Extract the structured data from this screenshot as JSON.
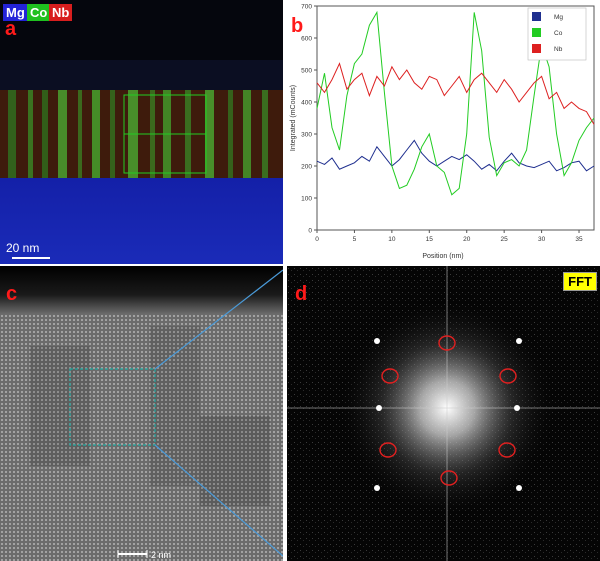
{
  "panel_a": {
    "label": "a",
    "legend": [
      {
        "name": "Mg",
        "color": "#2323d8"
      },
      {
        "name": "Co",
        "color": "#1fc01f"
      },
      {
        "name": "Nb",
        "color": "#d81e1e"
      }
    ],
    "scale_bar": "20 nm"
  },
  "panel_b": {
    "label": "b"
  },
  "panel_c": {
    "label": "c",
    "scale_bar": "2 nm"
  },
  "panel_d": {
    "label": "d",
    "badge": "FFT"
  },
  "chart_data": {
    "type": "line",
    "xlabel": "Position (nm)",
    "ylabel": "Integrated (mCounts)",
    "xlim": [
      0,
      37
    ],
    "ylim": [
      0,
      700
    ],
    "xticks": [
      "0",
      "5",
      "10",
      "15",
      "20",
      "25",
      "30",
      "35"
    ],
    "yticks": [
      "0",
      "100",
      "200",
      "300",
      "400",
      "500",
      "600",
      "700"
    ],
    "grid": false,
    "legend_position": "top-right",
    "series": [
      {
        "name": "Mg",
        "color": "#1f2f8f",
        "x": [
          0,
          1,
          2,
          3,
          4,
          5,
          6,
          7,
          8,
          9,
          10,
          11,
          12,
          13,
          14,
          15,
          16,
          17,
          18,
          19,
          20,
          21,
          22,
          23,
          24,
          25,
          26,
          27,
          28,
          29,
          30,
          31,
          32,
          33,
          34,
          35,
          36,
          37
        ],
        "y": [
          215,
          205,
          225,
          190,
          200,
          210,
          230,
          215,
          260,
          230,
          200,
          220,
          250,
          280,
          240,
          215,
          200,
          215,
          230,
          220,
          235,
          215,
          190,
          205,
          185,
          215,
          240,
          210,
          200,
          195,
          205,
          215,
          185,
          195,
          210,
          215,
          185,
          200
        ]
      },
      {
        "name": "Co",
        "color": "#22cc22",
        "x": [
          0,
          1,
          2,
          3,
          4,
          5,
          6,
          7,
          8,
          9,
          10,
          11,
          12,
          13,
          14,
          15,
          16,
          17,
          18,
          19,
          20,
          21,
          22,
          23,
          24,
          25,
          26,
          27,
          28,
          29,
          30,
          31,
          32,
          33,
          34,
          35,
          36,
          37
        ],
        "y": [
          380,
          490,
          320,
          250,
          420,
          520,
          550,
          640,
          680,
          430,
          200,
          130,
          140,
          190,
          260,
          300,
          200,
          180,
          110,
          130,
          300,
          680,
          560,
          290,
          170,
          210,
          220,
          200,
          250,
          420,
          580,
          510,
          300,
          170,
          210,
          280,
          320,
          350
        ]
      },
      {
        "name": "Nb",
        "color": "#dd2020",
        "x": [
          0,
          1,
          2,
          3,
          4,
          5,
          6,
          7,
          8,
          9,
          10,
          11,
          12,
          13,
          14,
          15,
          16,
          17,
          18,
          19,
          20,
          21,
          22,
          23,
          24,
          25,
          26,
          27,
          28,
          29,
          30,
          31,
          32,
          33,
          34,
          35,
          36,
          37
        ],
        "y": [
          460,
          430,
          470,
          520,
          440,
          470,
          490,
          420,
          480,
          450,
          510,
          470,
          500,
          460,
          440,
          480,
          470,
          420,
          450,
          480,
          430,
          470,
          490,
          460,
          430,
          470,
          440,
          400,
          430,
          460,
          480,
          410,
          430,
          380,
          400,
          380,
          370,
          330
        ]
      }
    ]
  }
}
